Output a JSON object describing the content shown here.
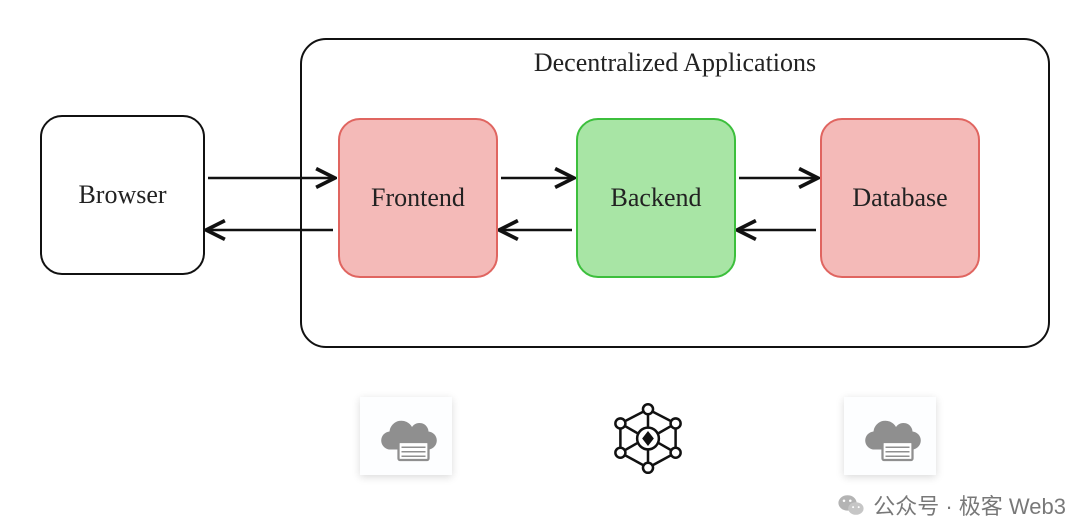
{
  "diagram": {
    "title": "Decentralized Applications",
    "nodes": {
      "browser": {
        "label": "Browser"
      },
      "frontend": {
        "label": "Frontend",
        "fill": "#F4BAB8",
        "stroke": "#E06560"
      },
      "backend": {
        "label": "Backend",
        "fill": "#A8E5A5",
        "stroke": "#3CBF3C"
      },
      "database": {
        "label": "Database",
        "fill": "#F4BAB8",
        "stroke": "#E06560"
      }
    },
    "edges": [
      {
        "from": "browser",
        "to": "frontend",
        "bidirectional": true
      },
      {
        "from": "frontend",
        "to": "backend",
        "bidirectional": true
      },
      {
        "from": "backend",
        "to": "database",
        "bidirectional": true
      }
    ],
    "icons": {
      "frontend_host": "cloud-server-icon",
      "backend_host": "blockchain-network-icon",
      "database_host": "cloud-server-icon"
    }
  },
  "watermark": {
    "label": "公众号 · 极客 Web3"
  }
}
